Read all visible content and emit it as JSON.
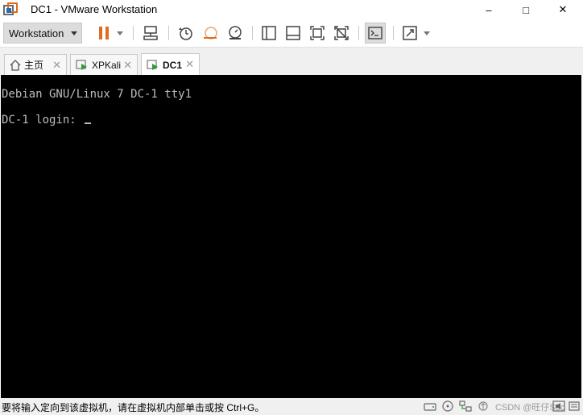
{
  "window": {
    "title": "DC1 - VMware Workstation",
    "minimize_label": "–",
    "maximize_label": "□",
    "close_label": "✕"
  },
  "toolbar": {
    "menu_label": "Workstation",
    "accent_color": "#e06c1d"
  },
  "tabs": [
    {
      "label": "主页",
      "icon": "home-icon"
    },
    {
      "label": "XPKali",
      "icon": "vm-running-icon"
    },
    {
      "label": "DC1",
      "icon": "vm-running-icon",
      "active": true
    }
  ],
  "console": {
    "line1": "Debian GNU/Linux 7 DC-1 tty1",
    "line2": "DC-1 login: "
  },
  "status": {
    "text": "要将输入定向到该虚拟机，请在虚拟机内部单击或按 Ctrl+G。",
    "watermark": "CSDN @旺仔Sec"
  }
}
